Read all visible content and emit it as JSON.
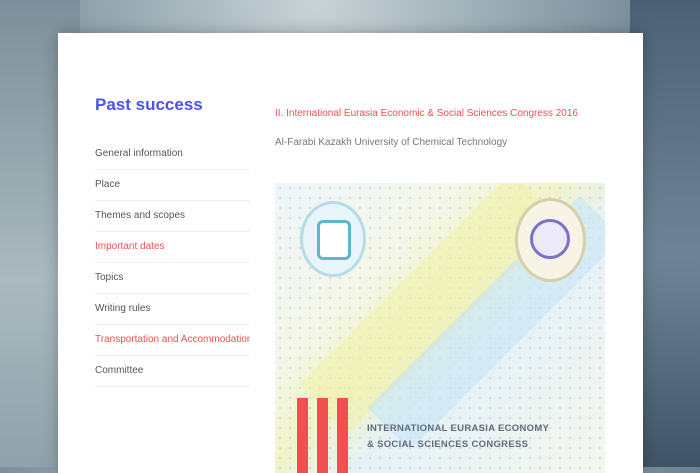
{
  "sidebar": {
    "title": "Past success",
    "items": [
      {
        "label": "General information",
        "active": false
      },
      {
        "label": "Place",
        "active": false
      },
      {
        "label": "Themes and scopes",
        "active": false
      },
      {
        "label": "Important dates",
        "active": true
      },
      {
        "label": "Topics",
        "active": false
      },
      {
        "label": "Writing rules",
        "active": false
      },
      {
        "label": "Transportation and Accommodation",
        "active": true
      },
      {
        "label": "Committee",
        "active": false
      }
    ]
  },
  "main": {
    "conference_title": "II. International Eurasia Economic & Social Sciences Congress 2016",
    "conference_subtitle": "Al-Farabi Kazakh University of Chemical Technology"
  },
  "poster": {
    "text_line1": "INTERNATIONAL EURASIA ECONOMY",
    "text_line2": "& SOCIAL SCIENCES CONGRESS",
    "accent_color": "#f05050"
  }
}
